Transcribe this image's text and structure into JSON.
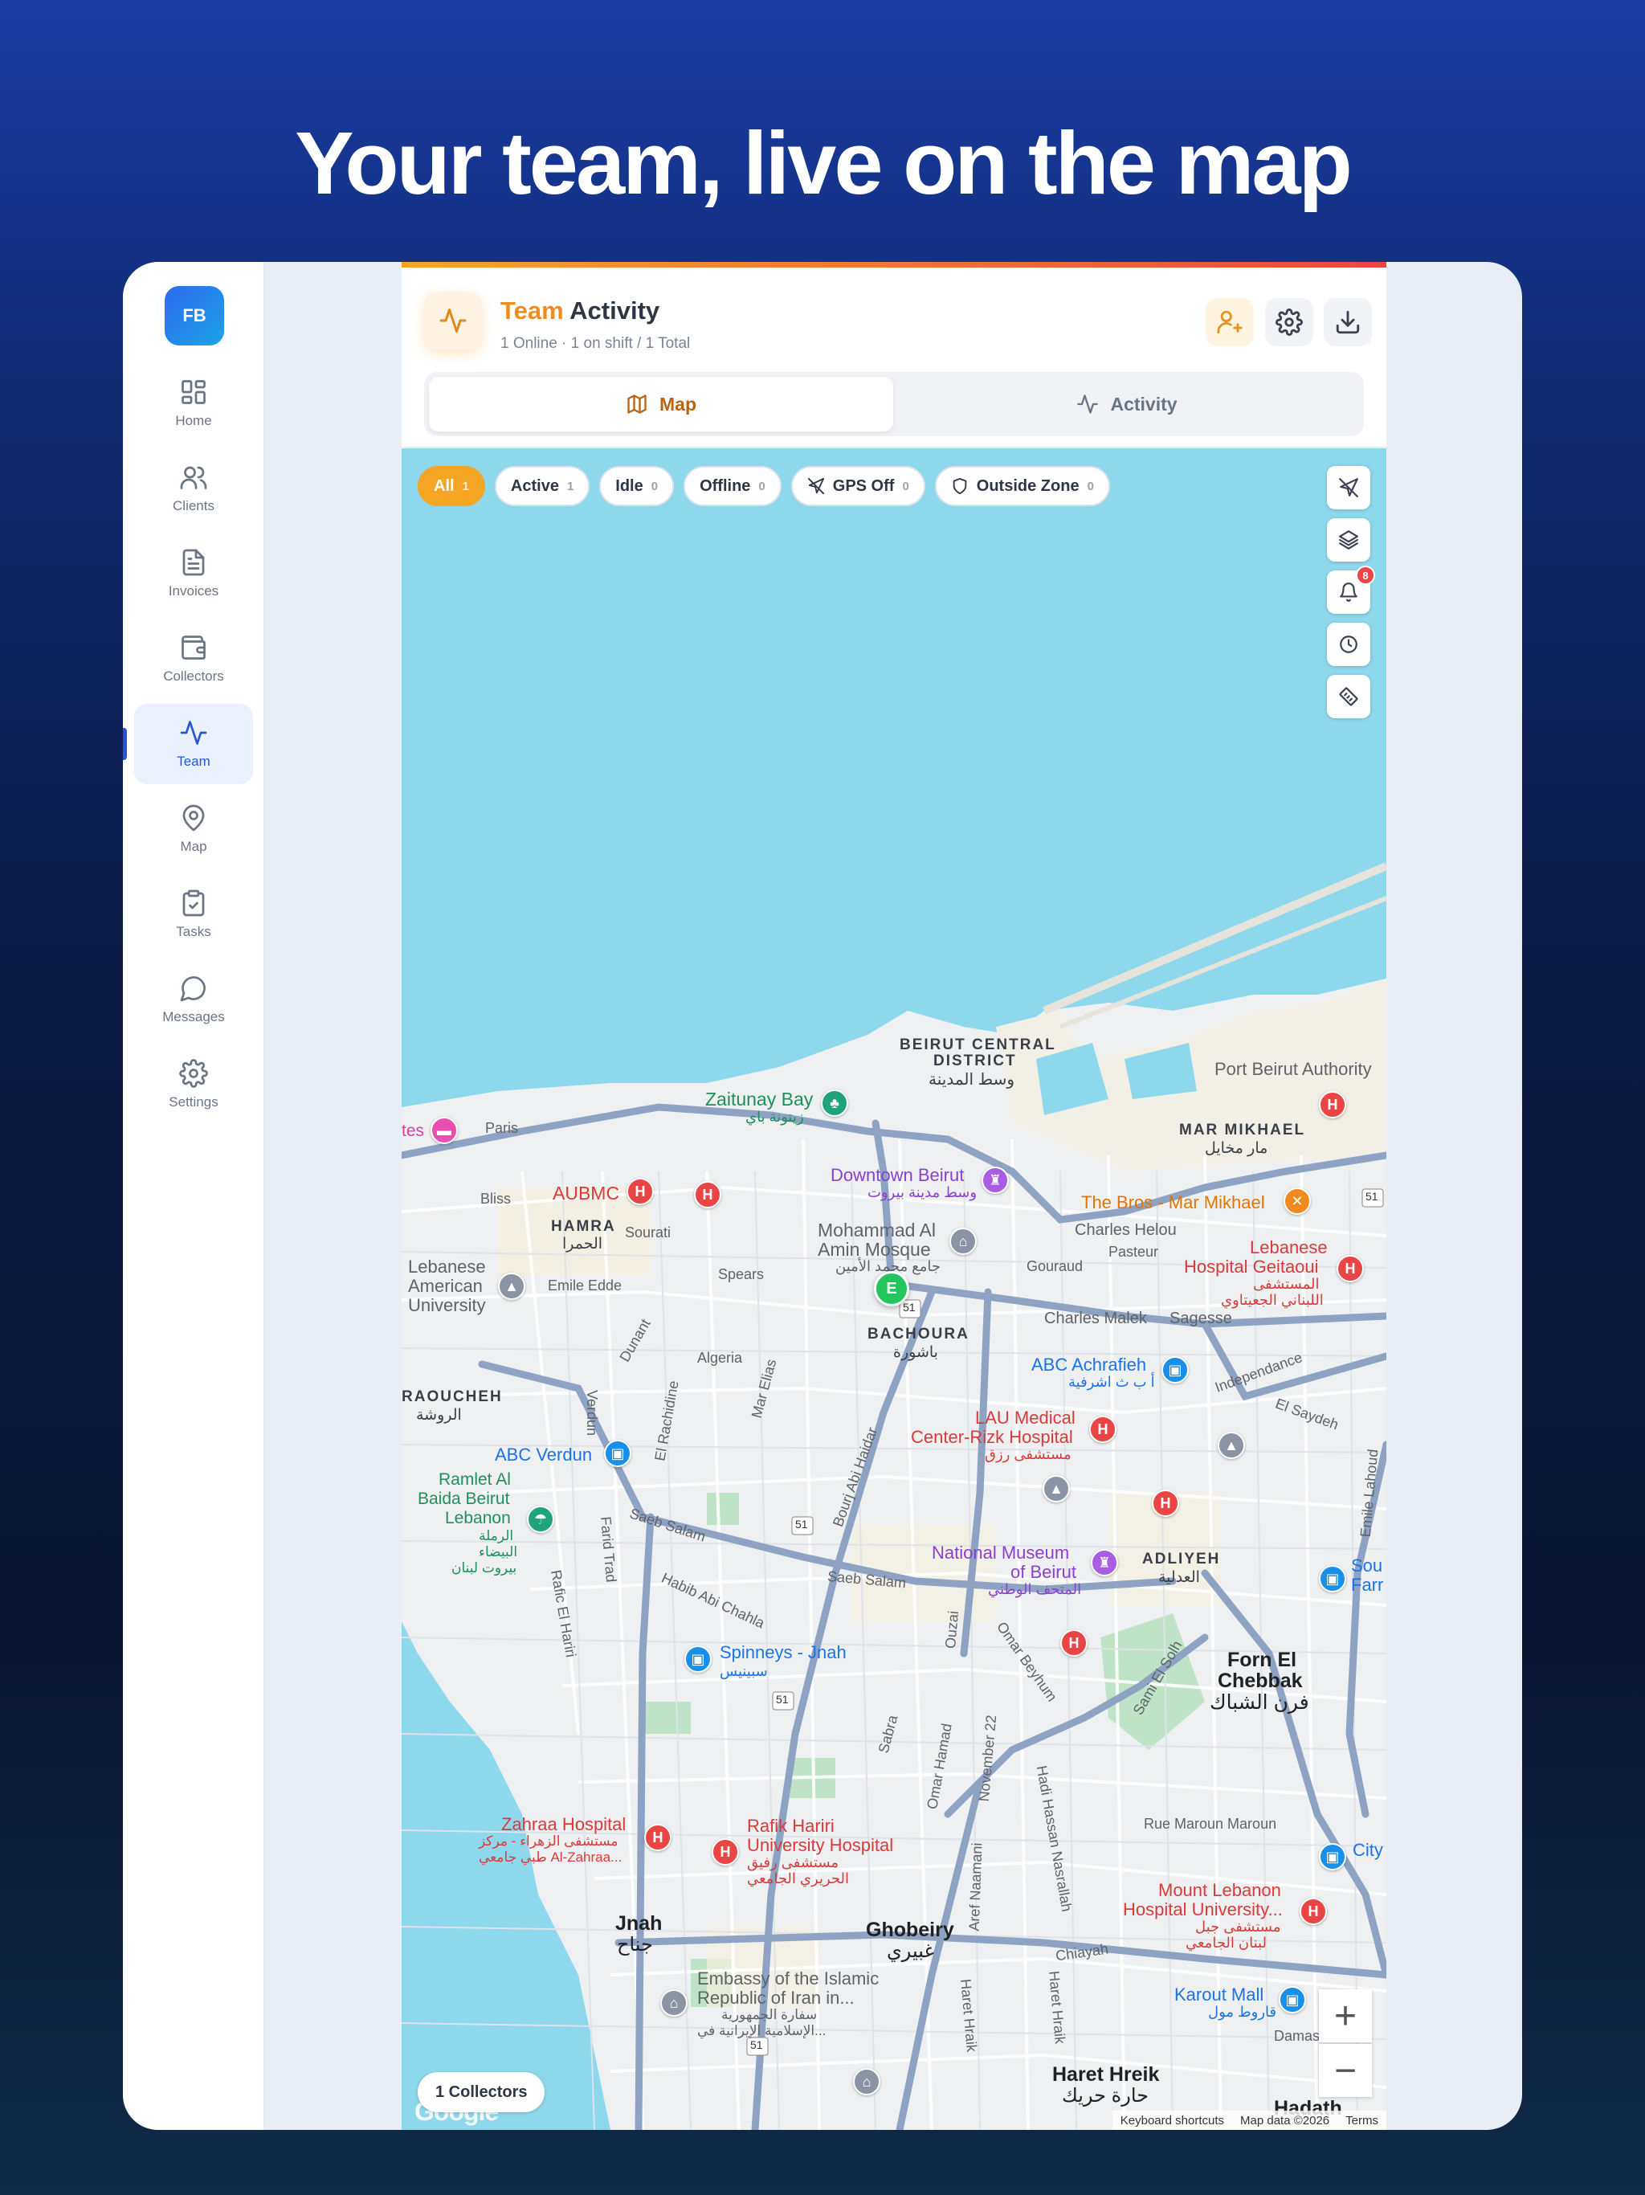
{
  "headline": "Your team, live on the map",
  "app": {
    "logo_text": "FB",
    "nav": [
      {
        "label": "Home",
        "icon": "grid-icon"
      },
      {
        "label": "Clients",
        "icon": "users-icon"
      },
      {
        "label": "Invoices",
        "icon": "file-icon"
      },
      {
        "label": "Collectors",
        "icon": "wallet-icon"
      },
      {
        "label": "Team",
        "icon": "activity-icon",
        "active": true
      },
      {
        "label": "Map",
        "icon": "map-pin-icon"
      },
      {
        "label": "Tasks",
        "icon": "clipboard-check-icon"
      },
      {
        "label": "Messages",
        "icon": "message-icon"
      },
      {
        "label": "Settings",
        "icon": "gear-icon"
      }
    ]
  },
  "header": {
    "title_accent": "Team",
    "title_rest": "Activity",
    "subtitle": "1 Online · 1 on shift / 1 Total",
    "accent_color": "#f08c1e"
  },
  "tabs": [
    {
      "label": "Map",
      "active": true
    },
    {
      "label": "Activity",
      "active": false
    }
  ],
  "filters": [
    {
      "label": "All",
      "count": "1",
      "active": true
    },
    {
      "label": "Active",
      "count": "1"
    },
    {
      "label": "Idle",
      "count": "0"
    },
    {
      "label": "Offline",
      "count": "0"
    },
    {
      "label": "GPS Off",
      "count": "0"
    },
    {
      "label": "Outside Zone",
      "count": "0"
    }
  ],
  "map_controls": {
    "alerts_badge": "8",
    "zoom_in": "+",
    "zoom_out": "−",
    "collectors_count": "1 Collectors",
    "collector_marker": "E",
    "attribution": [
      "Keyboard shortcuts",
      "Map data ©2026",
      "Terms"
    ],
    "google_logo": "Google"
  },
  "map_labels": {
    "beirut_central": "BEIRUT CENTRAL",
    "district": "DISTRICT",
    "beirut_central_ar": "وسط المدينة",
    "zaitunay": "Zaitunay Bay",
    "zaitunay_ar": "زيتونة باي",
    "port": "Port Beirut Authority",
    "mar_mikhael": "MAR MIKHAEL",
    "mar_mikhael_ar": "مار مخايل",
    "paris": "Paris",
    "tes": "tes",
    "aubmc": "AUBMC",
    "downtown": "Downtown Beirut",
    "downtown_ar": "وسط مدينة بيروت",
    "the_bros": "The Bros - Mar Mikhael",
    "bliss": "Bliss",
    "hamra": "HAMRA",
    "hamra_ar": "الحمرا",
    "sourati": "Sourati",
    "mosque1": "Mohammad Al",
    "mosque2": "Amin Mosque",
    "mosque_ar": "جامع محمد الأمين",
    "charles_helou": "Charles Helou",
    "pasteur": "Pasteur",
    "lebanese_hosp1": "Lebanese",
    "lebanese_hosp2": "Hospital Geitaoui",
    "lebanese_hosp_ar1": "المستشفى",
    "lebanese_hosp_ar2": "اللبناني الجعيتاوي",
    "lau_uni1": "Lebanese",
    "lau_uni2": "American",
    "lau_uni3": "University",
    "emile_edde": "Emile Edde",
    "spears": "Spears",
    "gouraud": "Gouraud",
    "charles_malek": "Charles Malek",
    "sagesse": "Sagesse",
    "bachoura": "BACHOURA",
    "bachoura_ar": "باشورة",
    "dunant": "Dunant",
    "algeria": "Algeria",
    "abc_achrafieh": "ABC Achrafieh",
    "abc_achrafieh_ar": "أ ب ث اشرفية",
    "independance": "Independance",
    "el_saydeh": "El Saydeh",
    "raoucheh": "RAOUCHEH",
    "raoucheh_ar": "الروشة",
    "verdun": "Verdun",
    "el_rachidine": "El Rachidine",
    "mar_elias": "Mar Elias",
    "bourj": "Bourj Abi Haidar",
    "lau_med1": "LAU Medical",
    "lau_med2": "Center-Rizk Hospital",
    "lau_med_ar": "مستشفى رزق",
    "abc_verdun": "ABC Verdun",
    "ramlet1": "Ramlet Al",
    "ramlet2": "Baida Beirut",
    "ramlet3": "Lebanon",
    "ramlet_ar1": "الرملة",
    "ramlet_ar2": "البيضاء",
    "ramlet_ar3": "بيروت لبنان",
    "farid_trad": "Farid Trad",
    "saeb_salam": "Saeb Salam",
    "saeb_salam2": "Saeb Salam",
    "rafic_hariri": "Rafic El Hariri",
    "habib": "Habib Abi Chahla",
    "museum1": "National Museum",
    "museum2": "of Beirut",
    "museum_ar": "المتحف الوطني",
    "adliyeh": "ADLIYEH",
    "adliyeh_ar": "العدلية",
    "sou": "Sou",
    "farr": "Farr",
    "ouzai": "Ouzai",
    "omar_beyhum": "Omar Beyhum",
    "sami_solh": "Sami El Solh",
    "emile_lahoud": "Emile Lahoud",
    "forn1": "Forn El",
    "forn2": "Chebbak",
    "forn_ar": "فرن الشباك",
    "spinneys": "Spinneys - Jnah",
    "spinneys_ar": "سبينيس",
    "sabra": "Sabra",
    "omar_hamad": "Omar Hamad",
    "nov22": "November 22",
    "zahraa1": "Zahraa Hospital",
    "zahraa_ar1": "مستشفى الزهراء - مركز",
    "zahraa_ar2": "طبي جامعي Al-Zahraa...",
    "rafik1": "Rafik Hariri",
    "rafik2": "University Hospital",
    "rafik_ar1": "مستشفى رفيق",
    "rafik_ar2": "الحريري الجامعي",
    "rue_maroun": "Rue Maroun Maroun",
    "city": "City",
    "mount_leb1": "Mount Lebanon",
    "mount_leb2": "Hospital University...",
    "mount_leb_ar1": "مستشفى جبل",
    "mount_leb_ar2": "لبنان الجامعي",
    "jnah": "Jnah",
    "jnah_ar": "جناح",
    "ghobeiry": "Ghobeiry",
    "ghobeiry_ar": "غبيري",
    "aref_naamani": "Aref Naamani",
    "hadi_nasrallah": "Hadi Hassan Nasrallah",
    "chiayah": "Chiayah",
    "haret_hraik_st": "Haret Hraik",
    "haret_hraik_st2": "Haret Hraik",
    "embassy1": "Embassy of the Islamic",
    "embassy2": "Republic of Iran in...",
    "embassy_ar1": "سفارة الجمهورية",
    "embassy_ar2": "الإسلامية الإيرانية في...",
    "karout": "Karout Mall",
    "karout_ar": "قاروط مول",
    "damas": "Damas",
    "haret_hreik": "Haret Hreik",
    "haret_hreik_ar": "حارة حريك",
    "hadath": "Hadath",
    "road51_a": "51",
    "road51_b": "51",
    "road51_c": "51",
    "road51_d": "51",
    "road51_e": "51",
    "hotel_h": "H"
  }
}
